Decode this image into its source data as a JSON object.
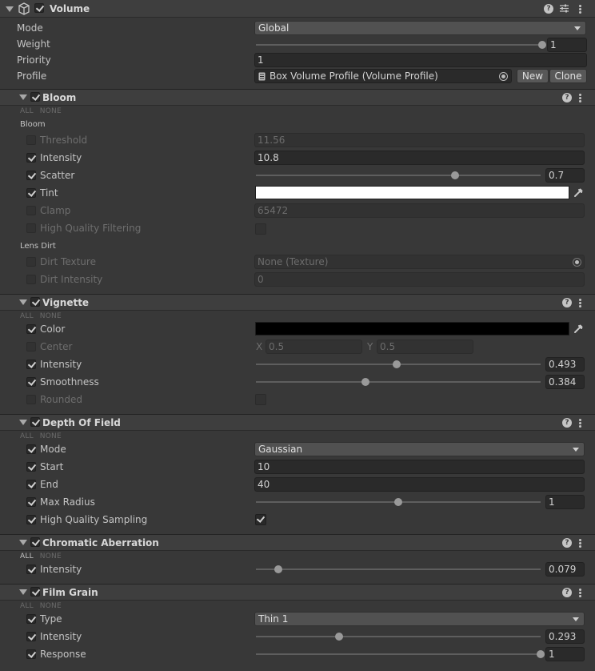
{
  "component": {
    "title": "Volume",
    "mode_label": "Mode",
    "mode_value": "Global",
    "weight_label": "Weight",
    "weight_value": "1",
    "weight_level": 1.0,
    "priority_label": "Priority",
    "priority_value": "1",
    "profile_label": "Profile",
    "profile_value": "Box Volume Profile (Volume Profile)",
    "new_label": "New",
    "clone_label": "Clone"
  },
  "all_label": "ALL",
  "none_label": "NONE",
  "bloom": {
    "title": "Bloom",
    "sub_bloom": "Bloom",
    "threshold_label": "Threshold",
    "threshold_value": "11.56",
    "intensity_label": "Intensity",
    "intensity_value": "10.8",
    "scatter_label": "Scatter",
    "scatter_value": "0.7",
    "scatter_level": 0.7,
    "tint_label": "Tint",
    "tint_color": "#ffffff",
    "clamp_label": "Clamp",
    "clamp_value": "65472",
    "hq_label": "High Quality Filtering",
    "sub_lens": "Lens Dirt",
    "dirt_texture_label": "Dirt Texture",
    "dirt_texture_value": "None (Texture)",
    "dirt_intensity_label": "Dirt Intensity",
    "dirt_intensity_value": "0"
  },
  "vignette": {
    "title": "Vignette",
    "color_label": "Color",
    "color": "#000000",
    "center_label": "Center",
    "x_label": "X",
    "center_x": "0.5",
    "y_label": "Y",
    "center_y": "0.5",
    "intensity_label": "Intensity",
    "intensity_value": "0.493",
    "intensity_level": 0.493,
    "smoothness_label": "Smoothness",
    "smoothness_value": "0.384",
    "smoothness_level": 0.384,
    "rounded_label": "Rounded"
  },
  "dof": {
    "title": "Depth Of Field",
    "mode_label": "Mode",
    "mode_value": "Gaussian",
    "start_label": "Start",
    "start_value": "10",
    "end_label": "End",
    "end_value": "40",
    "radius_label": "Max Radius",
    "radius_value": "1",
    "radius_level": 0.5,
    "hq_label": "High Quality Sampling"
  },
  "chroma": {
    "title": "Chromatic Aberration",
    "intensity_label": "Intensity",
    "intensity_value": "0.079",
    "intensity_level": 0.079
  },
  "grain": {
    "title": "Film Grain",
    "type_label": "Type",
    "type_value": "Thin 1",
    "intensity_label": "Intensity",
    "intensity_value": "0.293",
    "intensity_level": 0.293,
    "response_label": "Response",
    "response_value": "1",
    "response_level": 1.0
  },
  "colors": {
    "panel_bg": "#383838",
    "header_bg": "#3e3e3e",
    "field_bg": "#2a2a2a",
    "accent_text": "#c4c4c4"
  }
}
